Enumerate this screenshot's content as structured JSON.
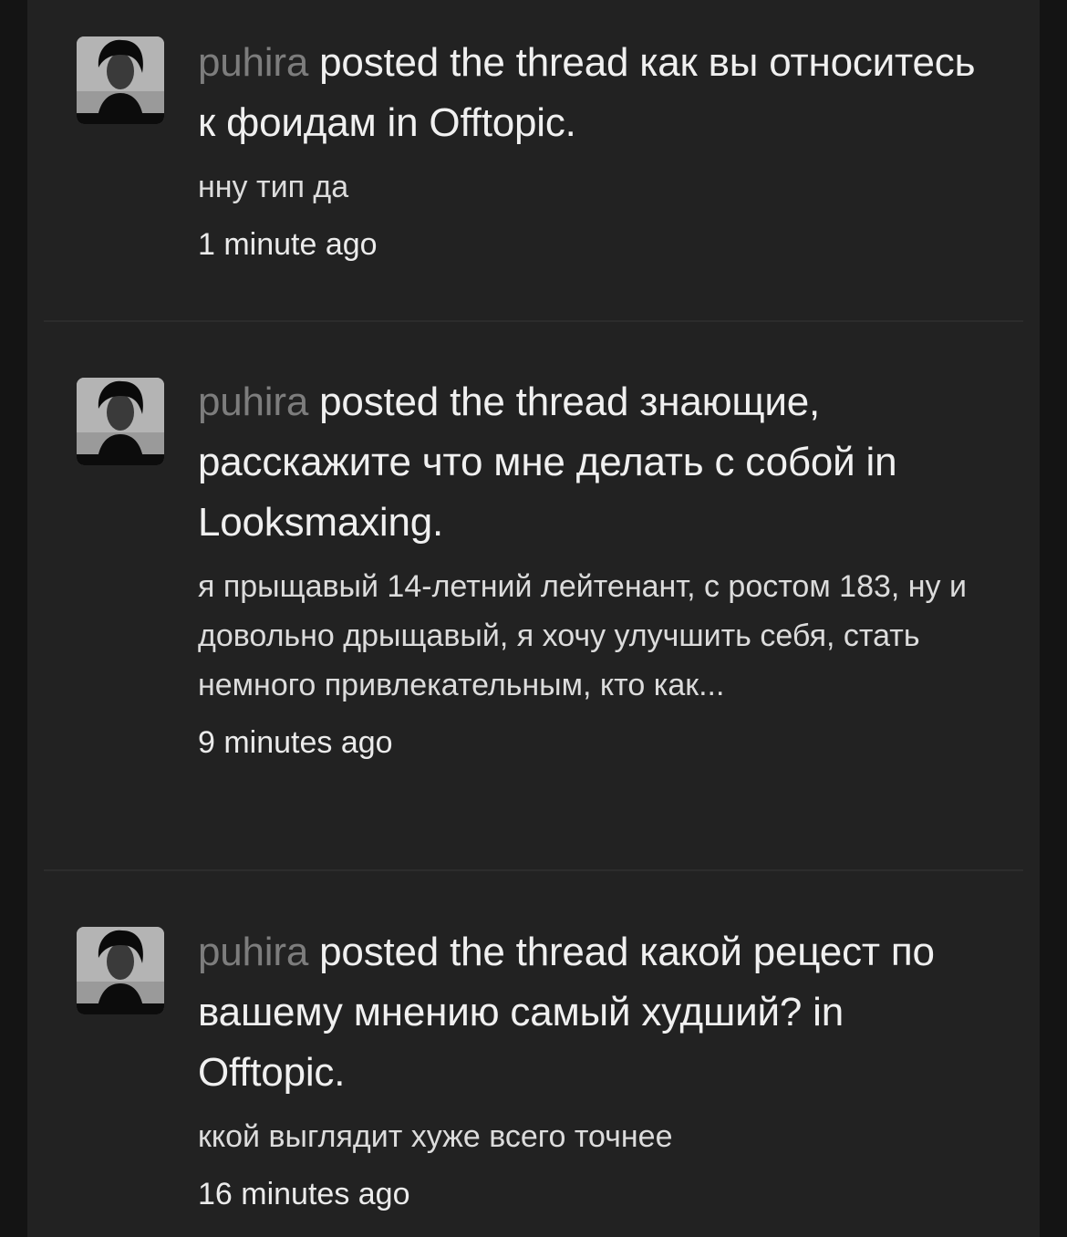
{
  "feed": {
    "items": [
      {
        "username": "puhira",
        "action": " posted the thread как вы относитесь к фоидам in Offtopic.",
        "snippet": "нну тип да",
        "time": "1 minute ago"
      },
      {
        "username": "puhira",
        "action": " posted the thread знающие, расскажите что мне делать с собой in Looksmaxing.",
        "snippet": "я прыщавый 14-летний лейтенант, с ростом 183, ну и довольно дрыщавый, я хочу улучшить себя, стать немного привлекательным, кто как...",
        "time": "9 minutes ago"
      },
      {
        "username": "puhira",
        "action": " posted the thread какой рецест по вашему мнению самый худший? in Offtopic.",
        "snippet": "ккой выглядит хуже всего точнее",
        "time": "16 minutes ago"
      }
    ]
  }
}
